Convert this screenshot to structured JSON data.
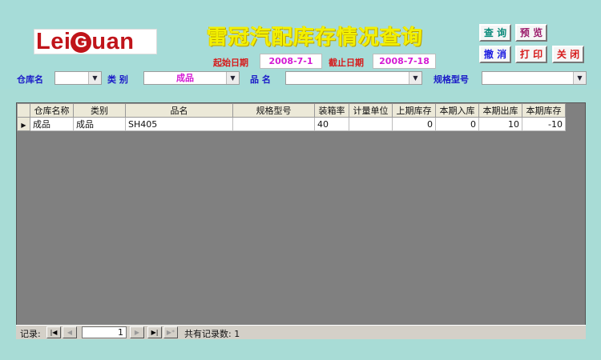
{
  "logo_text": "LeiGuan",
  "title": "雷冠汽配库存情况查询",
  "dates": {
    "start_label": "起始日期",
    "start_value": "2008-7-1",
    "end_label": "截止日期",
    "end_value": "2008-7-18"
  },
  "buttons": {
    "query": "查 询",
    "preview": "预 览",
    "cancel": "撤 消",
    "print": "打 印",
    "close": "关 闭"
  },
  "filters": {
    "warehouse_label": "仓库名",
    "warehouse_value": "",
    "category_label": "类 别",
    "category_value": "成品",
    "product_label": "品 名",
    "product_value": "",
    "spec_label": "规格型号",
    "spec_value": ""
  },
  "icons": {
    "dropdown": "chevron-down-icon",
    "current_record": "record-pointer-icon",
    "nav_first": "first-record-icon",
    "nav_prev": "previous-record-icon",
    "nav_next": "next-record-icon",
    "nav_last": "last-record-icon",
    "nav_new": "new-record-icon"
  },
  "table": {
    "columns": [
      "仓库名称",
      "类别",
      "品名",
      "规格型号",
      "装箱率",
      "计量单位",
      "上期库存",
      "本期入库",
      "本期出库",
      "本期库存"
    ],
    "rows": [
      [
        "成品",
        "成品",
        "SH405",
        "",
        "40",
        "",
        "0",
        "0",
        "10",
        "-10"
      ]
    ]
  },
  "navigation": {
    "label": "记录:",
    "current_record": "1",
    "total_text": "共有记录数: 1"
  },
  "colors": {
    "background": "#a8dcd6",
    "title": "#f2f000",
    "date_label": "#d61a1a",
    "date_value": "#d41ad4",
    "filter_label": "#1a1ac8",
    "grid_empty": "#808080"
  }
}
